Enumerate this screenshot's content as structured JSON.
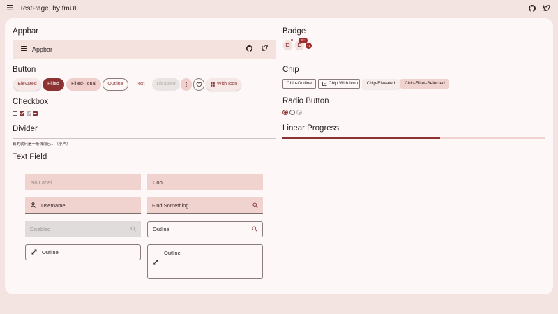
{
  "app": {
    "title": "TestPage, by fmUI."
  },
  "sections": {
    "appbar": "Appbar",
    "button": "Button",
    "checkbox": "Checkbox",
    "divider": "Divider",
    "text_field": "Text Field",
    "badge": "Badge",
    "chip": "Chip",
    "radio_button": "Radio Button",
    "linear_progress": "Linear Progress"
  },
  "appbar_demo": {
    "title": "Appbar"
  },
  "buttons": {
    "elevated": "Elevated",
    "filled": "Filled",
    "filled_tonal": "Filled-Tonal",
    "outline": "Outline",
    "text": "Text",
    "disabled": "Disabled",
    "with_icon": "With Icon"
  },
  "checkboxes": [
    {
      "state": "unchecked"
    },
    {
      "state": "checked"
    },
    {
      "state": "disabled"
    },
    {
      "state": "indeterminate"
    }
  ],
  "divider": {
    "text": "真的就只是一条线而已…（小声）"
  },
  "text_fields": {
    "no_label": {
      "placeholder": "No Label"
    },
    "cool": {
      "value": "Cool"
    },
    "username": {
      "label": "Username",
      "icon": "person-icon"
    },
    "find": {
      "label": "Find Something",
      "icon": "search-icon"
    },
    "disabled": {
      "label": "Disabled",
      "icon": "search-icon"
    },
    "outline_search": {
      "label": "Outline",
      "icon": "search-icon"
    },
    "outline_expand": {
      "label": "Outline",
      "icon": "expand-icon"
    },
    "outline_multiline": {
      "label": "Outline",
      "icon": "expand-icon"
    }
  },
  "badges": [
    {
      "type": "dot"
    },
    {
      "type": "count",
      "value": "99+"
    },
    {
      "type": "count",
      "value": "+1"
    }
  ],
  "chips": {
    "outline": "Chip-Outline",
    "with_icon": "Chip With Icon",
    "elevated": "Chip-Elevated",
    "filter_selected": "Chip-Filter-Selected"
  },
  "radios": [
    {
      "state": "selected"
    },
    {
      "state": "unselected"
    },
    {
      "state": "disabled"
    }
  ],
  "progress": {
    "value": 0.6
  },
  "colors": {
    "primary": "#8b3232",
    "surface": "#fdf8f7",
    "background": "#f3e3e1",
    "tonal": "#f0d2cf"
  },
  "icons": {
    "menu": "menu-icon",
    "github": "github-icon",
    "twitter": "twitter-icon"
  }
}
